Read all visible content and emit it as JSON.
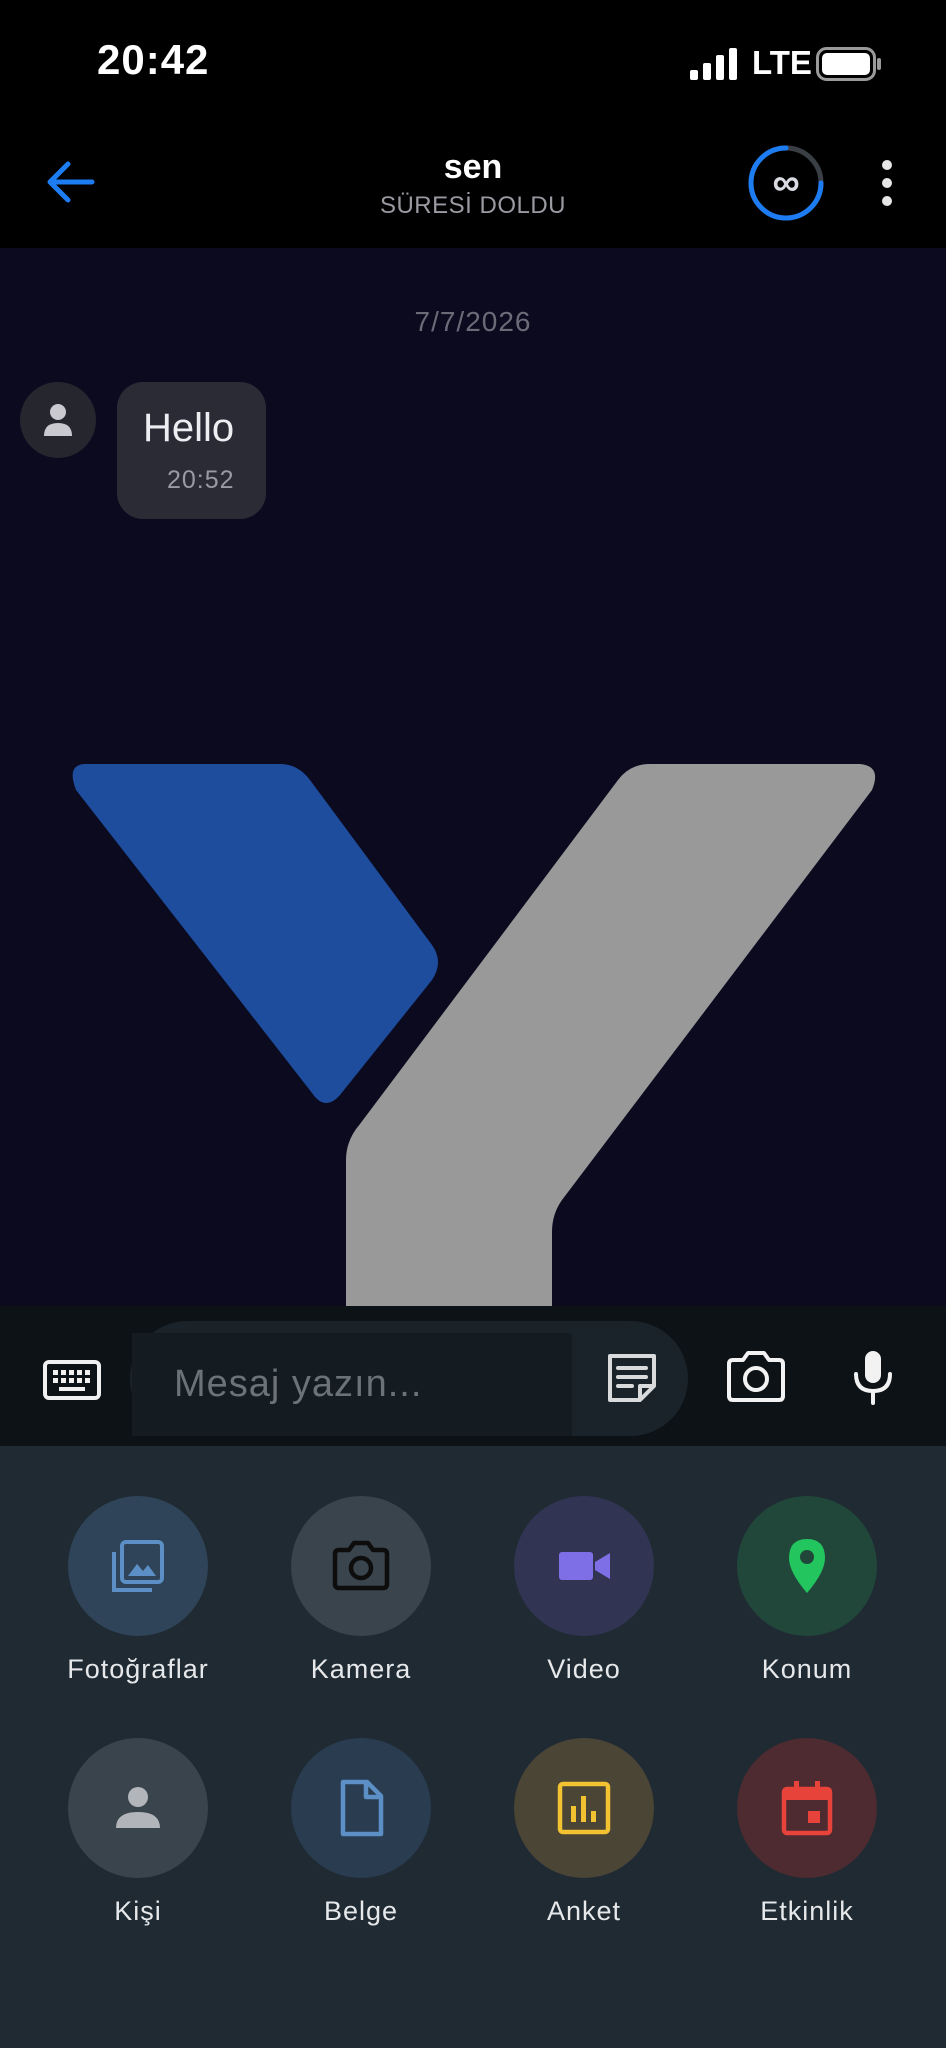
{
  "status_bar": {
    "time": "20:42",
    "network": "LTE"
  },
  "header": {
    "name": "sen",
    "status": "SÜRESİ DOLDU",
    "timer_value": "∞"
  },
  "chat": {
    "date_separator": "7/7/2026",
    "messages": [
      {
        "text": "Hello",
        "time": "20:52"
      }
    ]
  },
  "composer": {
    "placeholder": "Mesaj yazın..."
  },
  "attachments": [
    {
      "label": "Fotoğraflar",
      "icon": "photos-icon",
      "bg": "#2f4458",
      "color": "#5b8fc5"
    },
    {
      "label": "Kamera",
      "icon": "camera-icon",
      "bg": "#3a444c",
      "color": "#0d0d0d"
    },
    {
      "label": "Video",
      "icon": "video-icon",
      "bg": "#313553",
      "color": "#7f6fe6"
    },
    {
      "label": "Konum",
      "icon": "location-pin-icon",
      "bg": "#21473b",
      "color": "#22c55e"
    },
    {
      "label": "Kişi",
      "icon": "person-icon",
      "bg": "#3a444c",
      "color": "#b2b6ba"
    },
    {
      "label": "Belge",
      "icon": "document-icon",
      "bg": "#2a3c50",
      "color": "#5b8fc5"
    },
    {
      "label": "Anket",
      "icon": "poll-icon",
      "bg": "#4a4535",
      "color": "#f2c230"
    },
    {
      "label": "Etkinlik",
      "icon": "calendar-icon",
      "bg": "#4d2b30",
      "color": "#e8433a"
    }
  ],
  "colors": {
    "accent": "#1e7cf2",
    "logo_blue": "#1d4d9c",
    "logo_gray": "#999999"
  }
}
